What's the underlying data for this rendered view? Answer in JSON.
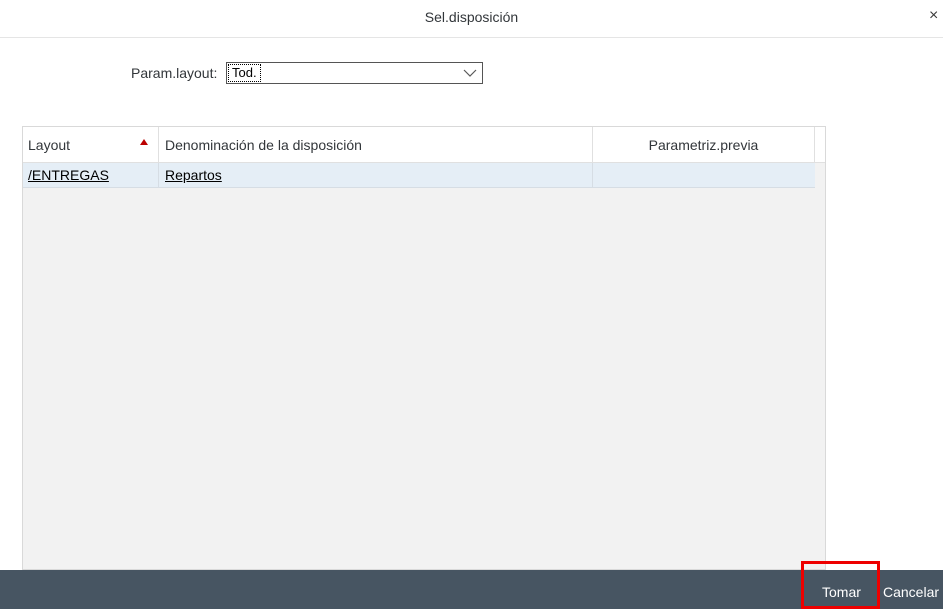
{
  "dialog": {
    "title": "Sel.disposición",
    "close_glyph": "×"
  },
  "param": {
    "label": "Param.layout:",
    "selected_value": "Tod."
  },
  "table": {
    "columns": [
      "Layout",
      "Denominación de la disposición",
      "Parametriz.previa"
    ],
    "sort_column": "Layout",
    "sort_direction": "ascending",
    "rows": [
      {
        "layout": "/ENTREGAS",
        "denomination": "Repartos",
        "preset": ""
      }
    ]
  },
  "footer": {
    "take_label": "Tomar",
    "cancel_label": "Cancelar"
  },
  "colors": {
    "footer_bg": "#475562",
    "selected_row_bg": "#e5eef6",
    "table_bg": "#f2f2f2",
    "highlight": "#ee0000",
    "sort_indicator": "#bb0000"
  },
  "icons": [
    "close-icon",
    "chevron-down-icon",
    "sort-ascending-icon"
  ]
}
